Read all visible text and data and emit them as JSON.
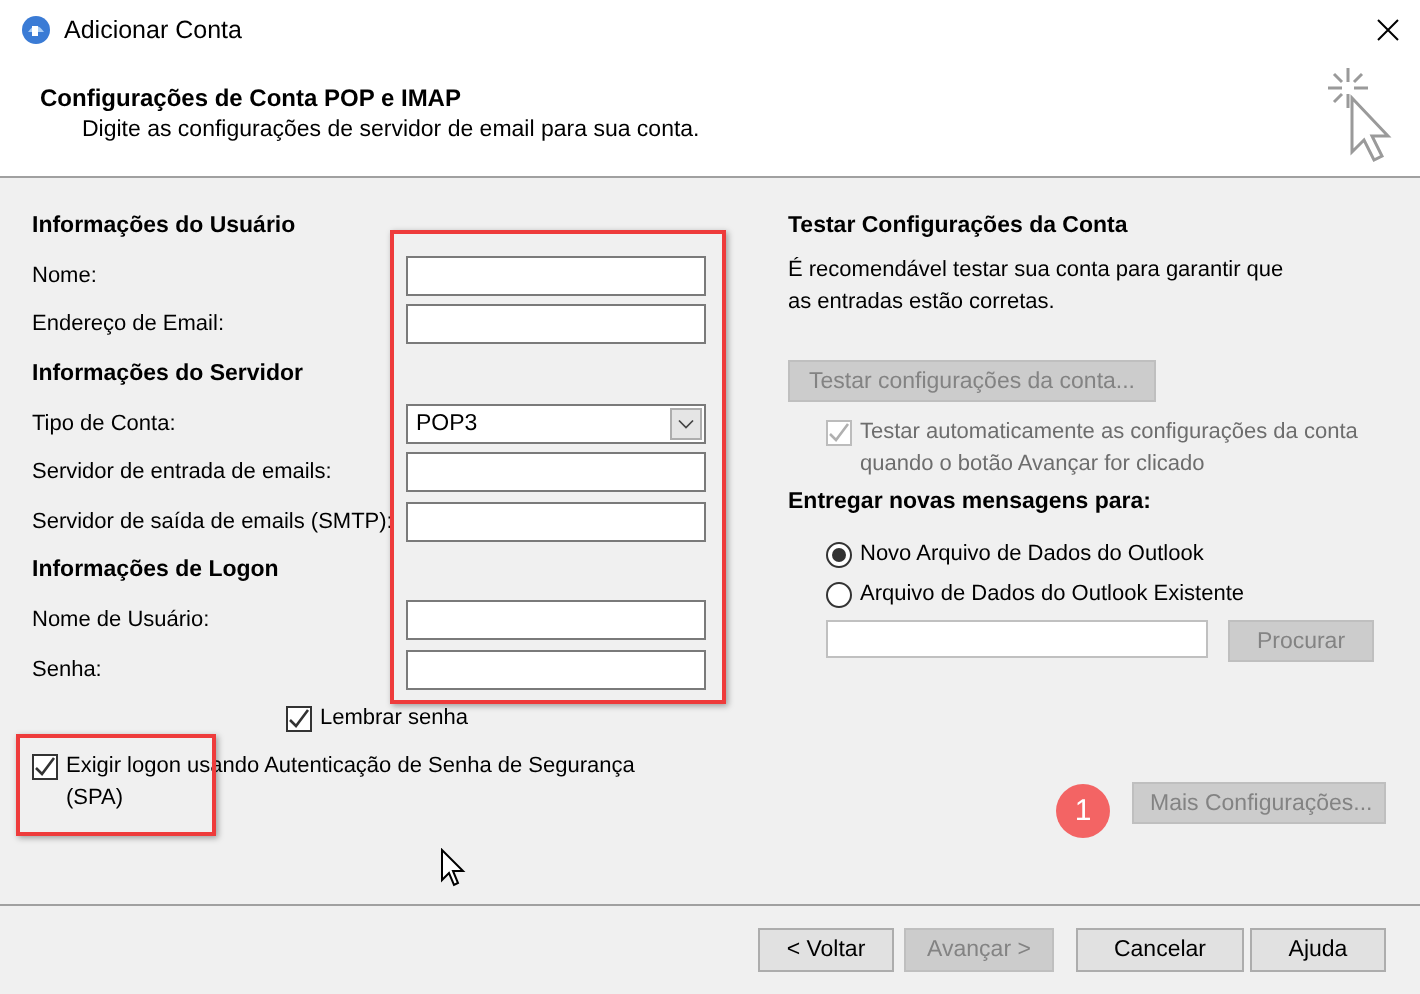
{
  "window": {
    "title": "Adicionar Conta"
  },
  "header": {
    "title": "Configurações de Conta POP e IMAP",
    "subtitle": "Digite as configurações de servidor de email para sua conta."
  },
  "sections": [
    {
      "heading": "Informações do Usuário",
      "fields": [
        {
          "label": "Nome:",
          "kind": "text"
        },
        {
          "label": "Endereço de Email:",
          "kind": "text"
        }
      ]
    },
    {
      "heading": "Informações do Servidor",
      "fields": [
        {
          "label": "Tipo de Conta:",
          "kind": "select",
          "value": "POP3"
        },
        {
          "label": "Servidor de entrada de emails:",
          "kind": "text"
        },
        {
          "label": "Servidor de saída de emails (SMTP):",
          "kind": "text"
        }
      ]
    },
    {
      "heading": "Informações de Logon",
      "fields": [
        {
          "label": "Nome de Usuário:",
          "kind": "text"
        },
        {
          "label": "Senha:",
          "kind": "text"
        }
      ]
    }
  ],
  "remember_password": {
    "label": "Lembrar senha",
    "checked": true
  },
  "spa": {
    "label": "Exigir logon usando Autenticação de Senha de Segurança (SPA)",
    "checked": true
  },
  "test_section": {
    "heading": "Testar Configurações da Conta",
    "description": "É recomendável testar sua conta para garantir que as entradas estão corretas.",
    "button": {
      "label": "Testar configurações da conta...",
      "disabled": true
    },
    "auto_test": {
      "label": "Testar automaticamente as configurações da conta quando o botão Avançar for clicado",
      "checked": true,
      "disabled": true
    }
  },
  "delivery": {
    "heading": "Entregar novas mensagens para:",
    "options": [
      {
        "label": "Novo Arquivo de Dados do Outlook",
        "selected": true
      },
      {
        "label": "Arquivo de Dados do Outlook Existente",
        "selected": false
      }
    ],
    "browse_button": {
      "label": "Procurar",
      "disabled": true
    }
  },
  "more_settings": {
    "label": "Mais Configurações...",
    "disabled": true
  },
  "annotations": [
    {
      "kind": "frame"
    },
    {
      "kind": "frame"
    },
    {
      "kind": "badge",
      "label": "1"
    }
  ],
  "footer_buttons": [
    {
      "label": "< Voltar",
      "disabled": false
    },
    {
      "label": "Avançar >",
      "disabled": true
    },
    {
      "label": "Cancelar",
      "disabled": false
    },
    {
      "label": "Ajuda",
      "disabled": false
    }
  ]
}
